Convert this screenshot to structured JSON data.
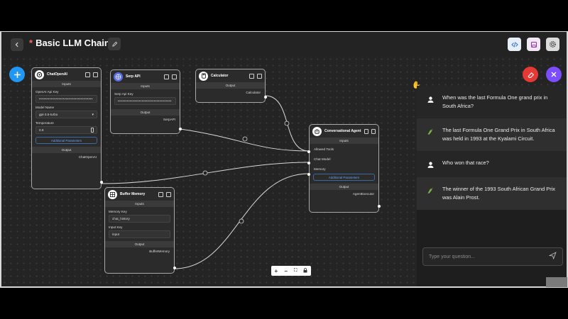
{
  "header": {
    "unsaved_marker": "*",
    "title": "Basic LLM Chain"
  },
  "icons": {
    "back": "chevron-left-icon",
    "edit": "pencil-icon",
    "code": "code-icon",
    "save": "save-icon",
    "settings": "gear-icon",
    "add": "plus-icon",
    "clear": "eraser-icon",
    "close": "close-icon"
  },
  "colors": {
    "accent_blue": "#2196f3",
    "clear_red": "#e53935",
    "close_purple": "#7c4dff",
    "link_blue": "#64a4ff"
  },
  "nodes": {
    "chat_openai": {
      "title": "ChatOpenAI",
      "inputs_label": "Inputs",
      "api_key_label": "OpenAI Api Key",
      "api_key_value": "••••••••••••••••••••••••••••••••••••",
      "model_label": "Model Name",
      "model_value": "gpt-3.5-turbo",
      "temperature_label": "Temperature",
      "temperature_value": "0.9",
      "additional_params": "Additional Parameters",
      "output_label": "Output",
      "output_name": "ChatOpenAI"
    },
    "serp_api": {
      "title": "Serp API",
      "inputs_label": "Inputs",
      "api_key_label": "Serp Api Key",
      "api_key_value": "••••••••••••••••••••••••••••••••••••",
      "output_label": "Output",
      "output_name": "SerpAPI"
    },
    "calculator": {
      "title": "Calculator",
      "output_label": "Output",
      "output_name": "Calculator"
    },
    "buffer_memory": {
      "title": "Buffer Memory",
      "inputs_label": "Inputs",
      "memory_key_label": "Memory Key",
      "memory_key_value": "chat_history",
      "input_key_label": "Input Key",
      "input_key_value": "input",
      "output_label": "Output",
      "output_name": "BufferMemory"
    },
    "conversational_agent": {
      "title": "Conversational Agent",
      "inputs_label": "Inputs",
      "allowed_tools": "Allowed Tools",
      "chat_model": "Chat Model",
      "memory": "Memory",
      "additional_params": "Additional Parameters",
      "output_label": "Output",
      "output_name": "AgentExecutor"
    }
  },
  "zoom_controls": [
    "+",
    "−",
    "⛶",
    "🔒"
  ],
  "chat": {
    "messages": [
      {
        "role": "user",
        "text": "When was the last Formula One grand prix in South Africa?"
      },
      {
        "role": "bot",
        "text": "The last Formula One Grand Prix in South Africa was held in 1993 at the Kyalami Circuit."
      },
      {
        "role": "user",
        "text": "Who won that race?"
      },
      {
        "role": "bot",
        "text": "The winner of the 1993 South African Grand Prix was Alain Prost."
      }
    ],
    "input_placeholder": "Type your question..."
  }
}
